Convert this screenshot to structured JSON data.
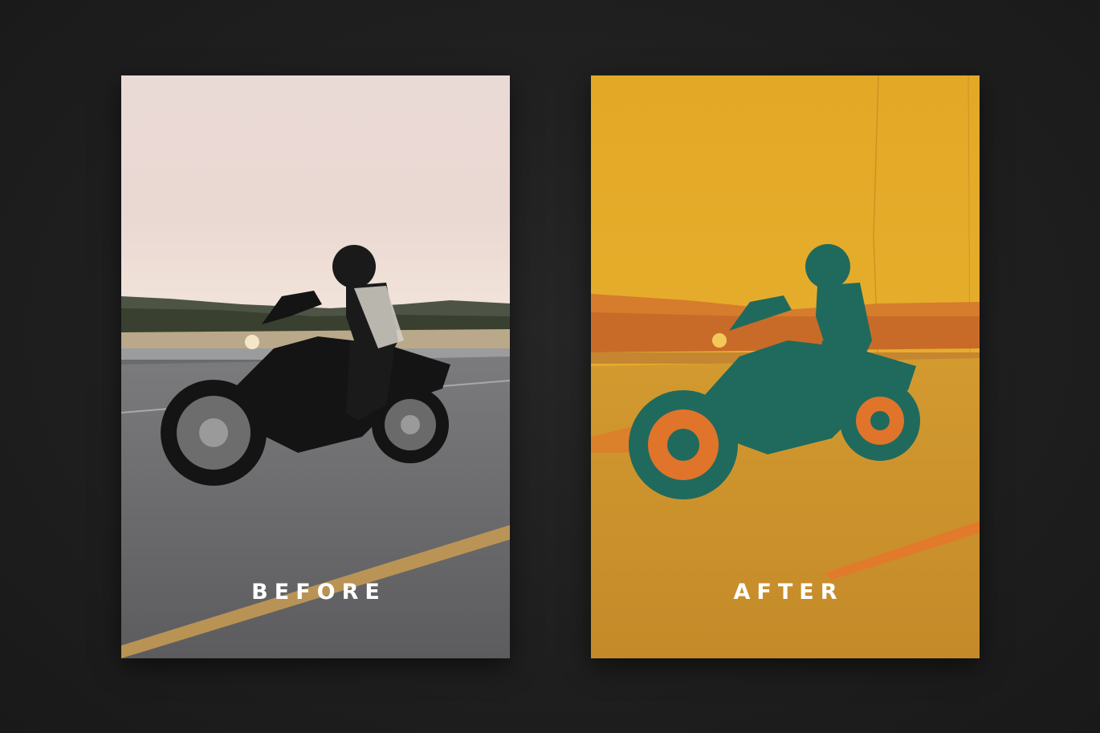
{
  "panels": {
    "before": {
      "label": "BEFORE",
      "colors": {
        "sky_top": "#e8d5d0",
        "sky_bottom": "#efe0d8",
        "hills": "#4b5143",
        "road": "#6f6f72",
        "road_line": "#c89a4c",
        "bike": "#151515"
      },
      "icon": "motorcycle-photo"
    },
    "after": {
      "label": "AFTER",
      "colors": {
        "background": "#e4a92a",
        "road": "#c8922e",
        "hills": "#d47a2c",
        "accent_orange": "#e0732a",
        "silhouette_teal": "#1f6b5e"
      },
      "icon": "motorcycle-duotone"
    }
  }
}
